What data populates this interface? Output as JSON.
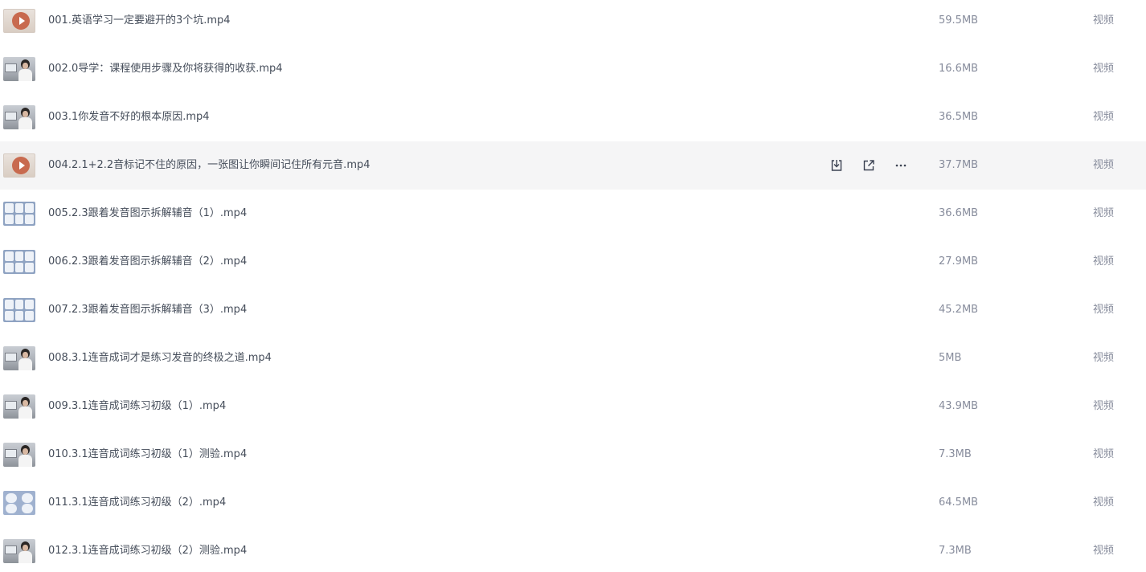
{
  "files": [
    {
      "name": "001.英语学习一定要避开的3个坑.mp4",
      "size": "59.5MB",
      "type": "视频",
      "thumb": "play-cover"
    },
    {
      "name": "002.0导学：课程使用步骤及你将获得的收获.mp4",
      "size": "16.6MB",
      "type": "视频",
      "thumb": "person"
    },
    {
      "name": "003.1你发音不好的根本原因.mp4",
      "size": "36.5MB",
      "type": "视频",
      "thumb": "person"
    },
    {
      "name": "004.2.1+2.2音标记不住的原因，一张图让你瞬间记住所有元音.mp4",
      "size": "37.7MB",
      "type": "视频",
      "thumb": "play-cover",
      "hovered": true
    },
    {
      "name": "005.2.3跟着发音图示拆解辅音（1）.mp4",
      "size": "36.6MB",
      "type": "视频",
      "thumb": "grid"
    },
    {
      "name": "006.2.3跟着发音图示拆解辅音（2）.mp4",
      "size": "27.9MB",
      "type": "视频",
      "thumb": "grid"
    },
    {
      "name": "007.2.3跟着发音图示拆解辅音（3）.mp4",
      "size": "45.2MB",
      "type": "视频",
      "thumb": "grid"
    },
    {
      "name": "008.3.1连音成词才是练习发音的终极之道.mp4",
      "size": "5MB",
      "type": "视频",
      "thumb": "person"
    },
    {
      "name": "009.3.1连音成词练习初级（1）.mp4",
      "size": "43.9MB",
      "type": "视频",
      "thumb": "person"
    },
    {
      "name": "010.3.1连音成词练习初级（1）测验.mp4",
      "size": "7.3MB",
      "type": "视频",
      "thumb": "person"
    },
    {
      "name": "011.3.1连音成词练习初级（2）.mp4",
      "size": "64.5MB",
      "type": "视频",
      "thumb": "faces"
    },
    {
      "name": "012.3.1连音成词练习初级（2）测验.mp4",
      "size": "7.3MB",
      "type": "视频",
      "thumb": "person"
    }
  ],
  "row_actions": {
    "download_icon": "download-icon",
    "share_icon": "share-icon",
    "more_icon": "more-icon"
  },
  "colors": {
    "name_text": "#454d5a",
    "meta_text": "#878c9c",
    "hover_row": "#f5f5f6"
  }
}
